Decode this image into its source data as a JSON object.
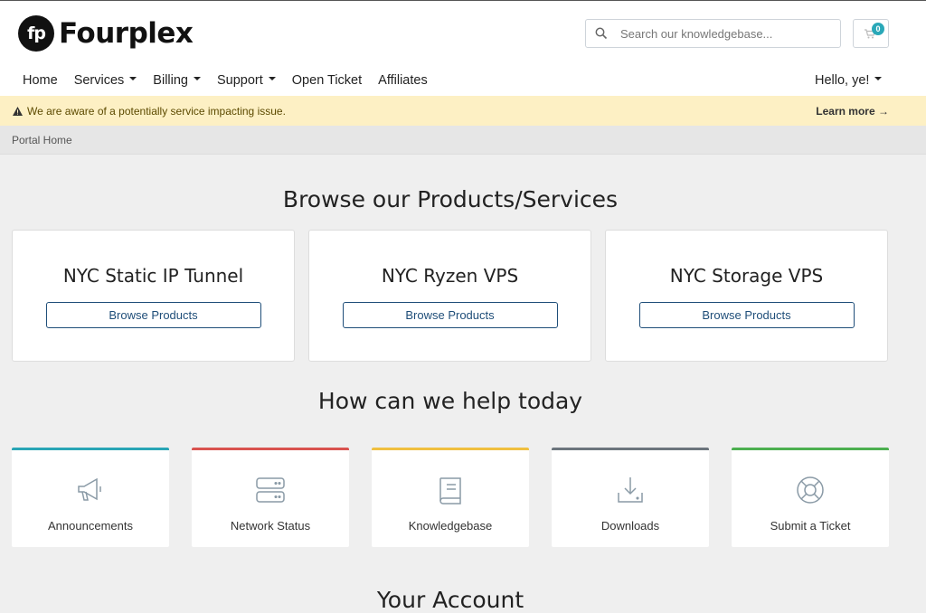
{
  "brand": {
    "logo_mark": "fp",
    "name": "Fourplex"
  },
  "search": {
    "placeholder": "Search our knowledgebase..."
  },
  "cart": {
    "count": "0"
  },
  "nav": {
    "items": [
      {
        "label": "Home",
        "dropdown": false
      },
      {
        "label": "Services",
        "dropdown": true
      },
      {
        "label": "Billing",
        "dropdown": true
      },
      {
        "label": "Support",
        "dropdown": true
      },
      {
        "label": "Open Ticket",
        "dropdown": false
      },
      {
        "label": "Affiliates",
        "dropdown": false
      }
    ],
    "user_greeting": "Hello, ye!"
  },
  "alert": {
    "message": "We are aware of a potentially service impacting issue.",
    "link": "Learn more →"
  },
  "breadcrumb": {
    "item": "Portal Home"
  },
  "products": {
    "title": "Browse our Products/Services",
    "cards": [
      {
        "name": "NYC Static IP Tunnel",
        "button": "Browse Products"
      },
      {
        "name": "NYC Ryzen VPS",
        "button": "Browse Products"
      },
      {
        "name": "NYC Storage VPS",
        "button": "Browse Products"
      }
    ]
  },
  "help": {
    "title": "How can we help today",
    "cards": [
      {
        "label": "Announcements",
        "icon": "megaphone-icon",
        "color": "#29a5b5"
      },
      {
        "label": "Network Status",
        "icon": "server-icon",
        "color": "#d9534f"
      },
      {
        "label": "Knowledgebase",
        "icon": "book-icon",
        "color": "#f0c040"
      },
      {
        "label": "Downloads",
        "icon": "download-icon",
        "color": "#6c757d"
      },
      {
        "label": "Submit a Ticket",
        "icon": "lifebuoy-icon",
        "color": "#4caf50"
      }
    ]
  },
  "account": {
    "title": "Your Account"
  }
}
